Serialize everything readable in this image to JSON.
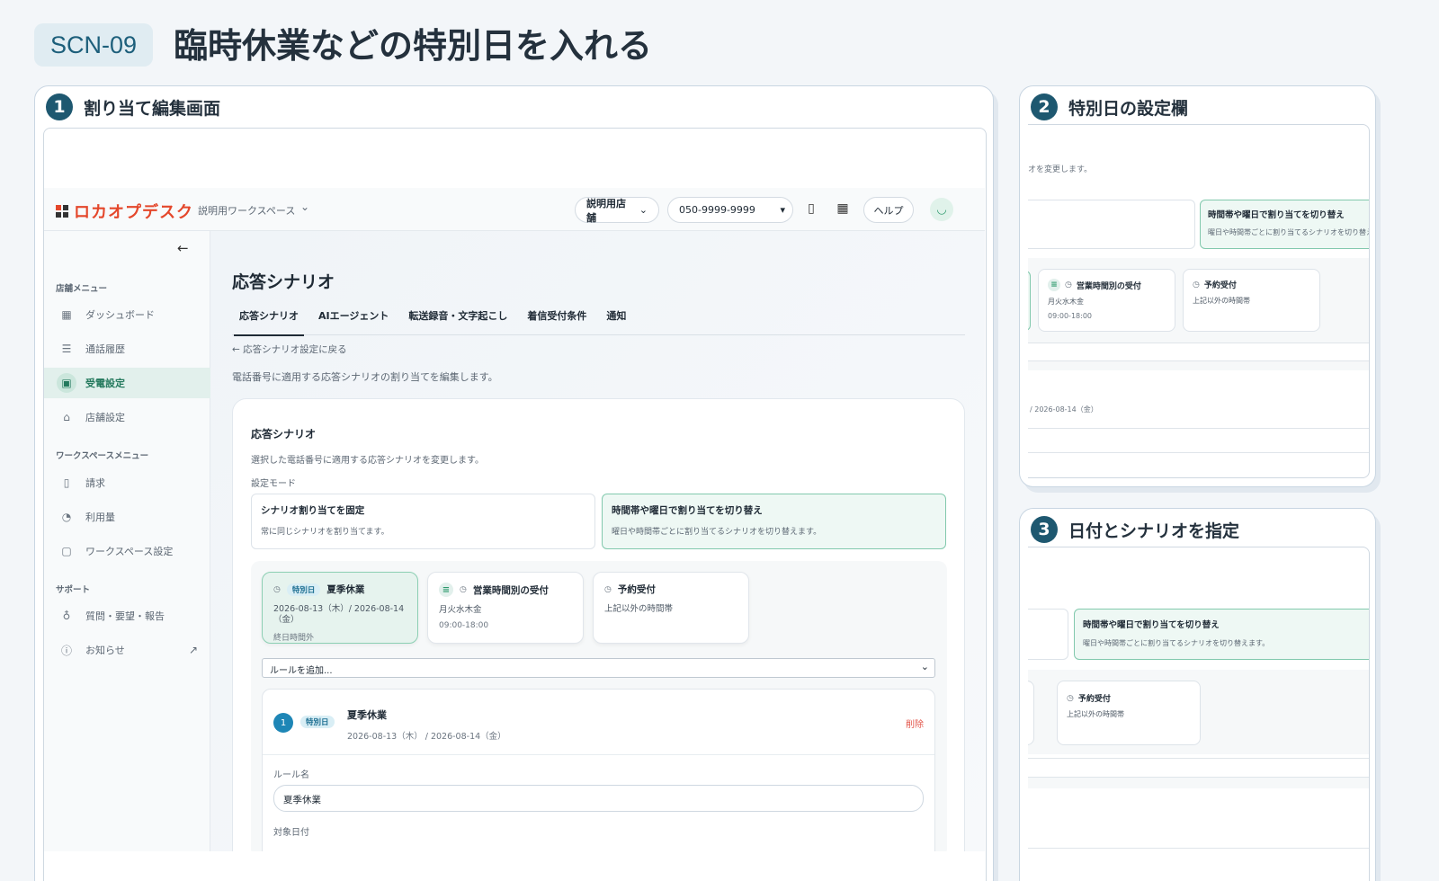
{
  "header": {
    "scn_id": "SCN-09",
    "title": "臨時休業などの特別日を入れる"
  },
  "panels": [
    {
      "num": "1",
      "title": "割り当て編集画面"
    },
    {
      "num": "2",
      "title": "特別日の設定欄"
    },
    {
      "num": "3",
      "title": "日付とシナリオを指定"
    }
  ],
  "app": {
    "logo": "ロカオプデスク",
    "workspace": "説明用ワークスペース",
    "store_select": "説明用店舗",
    "phone_select": "050-9999-9999",
    "help": "ヘルプ",
    "sidebar": {
      "store_menu": "店舗メニュー",
      "store_items": [
        "ダッシュボード",
        "通話履歴",
        "受電設定",
        "店舗設定"
      ],
      "ws_menu": "ワークスペースメニュー",
      "ws_items": [
        "請求",
        "利用量",
        "ワークスペース設定"
      ],
      "support": "サポート",
      "support_items": [
        "質問・要望・報告",
        "お知らせ"
      ]
    },
    "main": {
      "title": "応答シナリオ",
      "tabs": [
        "応答シナリオ",
        "AIエージェント",
        "転送録音・文字起こし",
        "着信受付条件",
        "通知"
      ],
      "back": "応答シナリオ設定に戻る",
      "desc": "電話番号に適用する応答シナリオの割り当てを編集します。",
      "card": {
        "title": "応答シナリオ",
        "desc": "選択した電話番号に適用する応答シナリオを変更します。",
        "mode_label": "設定モード",
        "mode_fixed": {
          "title": "シナリオ割り当てを固定",
          "desc": "常に同じシナリオを割り当てます。"
        },
        "mode_switch": {
          "title": "時間帯や曜日で割り当てを切り替え",
          "desc": "曜日や時間帯ごとに割り当てるシナリオを切り替えます。"
        },
        "rules": [
          {
            "badge": "特別日",
            "title": "夏季休業",
            "sub": "2026-08-13（木）/ 2026-08-14（金）",
            "sub2": "終日時間外"
          },
          {
            "title": "営業時間別の受付",
            "sub": "月火水木金",
            "sub2": "09:00-18:00"
          },
          {
            "title": "予約受付",
            "sub": "上記以外の時間帯"
          }
        ],
        "add_rule": "ルールを追加...",
        "detail": {
          "num": "1",
          "badge": "特別日",
          "title": "夏季休業",
          "date": "2026-08-13（木） / 2026-08-14（金）",
          "delete": "削除",
          "rule_name_label": "ルール名",
          "rule_name_value": "夏季休業",
          "target_date_label": "対象日付"
        }
      }
    }
  },
  "zoom2": {
    "desc_fragment": "オを変更します。",
    "mode_title": "時間帯や曜日で割り当てを切り替え",
    "mode_desc_fragment": "曜日や時間帯ごとに割り当てるシナリオを切り替え",
    "rule1_title": "営業時間別の受付",
    "rule1_sub": "月火水木金",
    "rule1_sub2": "09:00-18:00",
    "rule2_title": "予約受付",
    "rule2_sub": "上記以外の時間帯",
    "date_fragment": "/ 2026-08-14（金）"
  },
  "zoom3": {
    "mode_title": "時間帯や曜日で割り当てを切り替え",
    "mode_desc": "曜日や時間帯ごとに割り当てるシナリオを切り替えます。",
    "rule_title": "予約受付",
    "rule_sub": "上記以外の時間帯"
  }
}
